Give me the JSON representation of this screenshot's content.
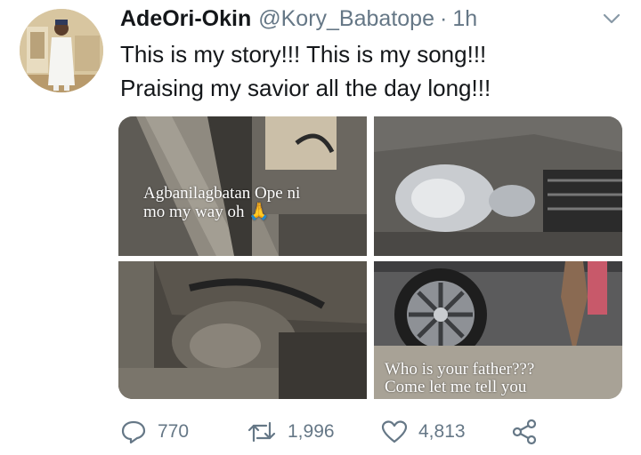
{
  "tweet": {
    "display_name": "AdeOri-Okin",
    "handle": "@Kory_Babatope",
    "separator": "·",
    "time": "1h",
    "text_line1": "This is my story!!! This is my song!!!",
    "text_line2": "Praising my savior all the day long!!!"
  },
  "media": {
    "photos": [
      {
        "caption_line1": "Agbanilagbatan Ope ni",
        "caption_line2": "mo my way oh 🙏"
      },
      {
        "caption_line1": "",
        "caption_line2": ""
      },
      {
        "caption_line1": "",
        "caption_line2": ""
      },
      {
        "caption_line1": "Who is your father???",
        "caption_line2": "Come let me tell you"
      }
    ]
  },
  "actions": {
    "reply_count": "770",
    "retweet_count": "1,996",
    "like_count": "4,813"
  },
  "icons": {
    "more": "chevron-down-icon",
    "reply": "reply-icon",
    "retweet": "retweet-icon",
    "like": "heart-icon",
    "share": "share-icon"
  },
  "colors": {
    "text_primary": "#14171a",
    "text_secondary": "#657786"
  }
}
